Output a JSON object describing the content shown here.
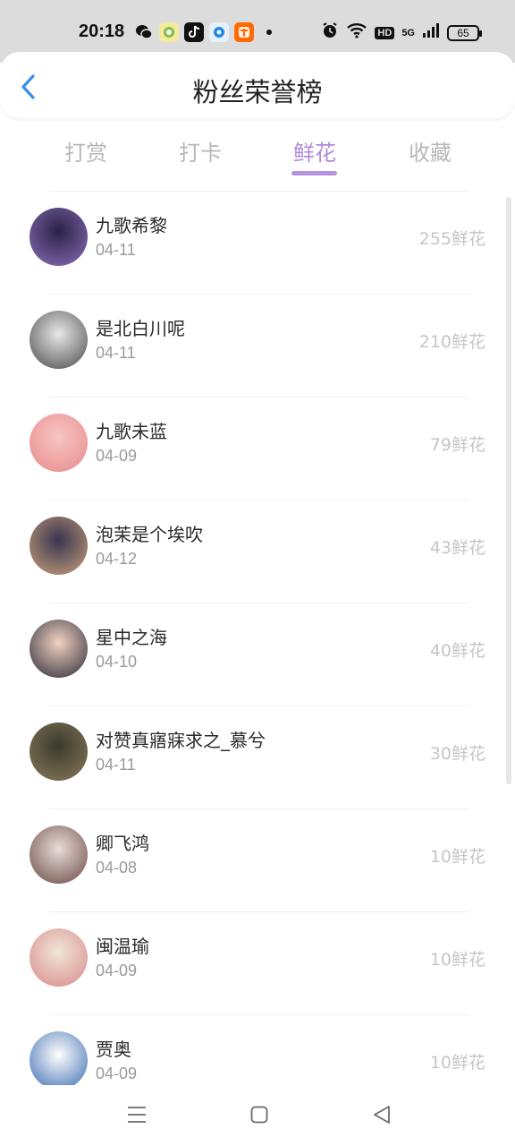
{
  "status_bar": {
    "time": "20:18",
    "battery": "65",
    "network_label": "HD",
    "cellular_label": "5G",
    "left_icons": [
      "wechat-icon",
      "app-icon",
      "tiktok-icon",
      "browser-icon",
      "taobao-icon"
    ],
    "right_icons": [
      "alarm-icon",
      "wifi-icon",
      "signal-icon",
      "battery-icon"
    ]
  },
  "header": {
    "title": "粉丝荣誉榜",
    "back_icon": "chevron-left-icon",
    "accent_color": "#3a8fe8"
  },
  "tabs": [
    {
      "label": "打赏",
      "active": false
    },
    {
      "label": "打卡",
      "active": false
    },
    {
      "label": "鲜花",
      "active": true
    },
    {
      "label": "收藏",
      "active": false
    }
  ],
  "tab_active_color": "#b08ad8",
  "fans": [
    {
      "name": "九歌希黎",
      "date": "04-11",
      "count": "255鲜花",
      "avatar_colors": [
        "#2a2146",
        "#8a6fb8"
      ]
    },
    {
      "name": "是北白川呢",
      "date": "04-11",
      "count": "210鲜花",
      "avatar_colors": [
        "#e8e8e8",
        "#4a4a4a"
      ]
    },
    {
      "name": "九歌未蓝",
      "date": "04-09",
      "count": "79鲜花",
      "avatar_colors": [
        "#f6c6c4",
        "#e88a8a"
      ]
    },
    {
      "name": "泡茉是个埃吹",
      "date": "04-12",
      "count": "43鲜花",
      "avatar_colors": [
        "#3a3550",
        "#c8a07a"
      ]
    },
    {
      "name": "星中之海",
      "date": "04-10",
      "count": "40鲜花",
      "avatar_colors": [
        "#f2d2c0",
        "#2a2a3a"
      ]
    },
    {
      "name": "对赞真寤寐求之_慕兮",
      "date": "04-11",
      "count": "30鲜花",
      "avatar_colors": [
        "#3a3a2e",
        "#8a7a5a"
      ]
    },
    {
      "name": "卿飞鸿",
      "date": "04-08",
      "count": "10鲜花",
      "avatar_colors": [
        "#e8dcd8",
        "#6a4a44"
      ]
    },
    {
      "name": "闽温瑜",
      "date": "04-09",
      "count": "10鲜花",
      "avatar_colors": [
        "#f0e6d8",
        "#d88a8a"
      ]
    },
    {
      "name": "贾奥",
      "date": "04-09",
      "count": "10鲜花",
      "avatar_colors": [
        "#ffffff",
        "#3a6ab0"
      ]
    }
  ],
  "nav_bar": {
    "icons": [
      "menu-icon",
      "home-icon",
      "back-icon"
    ]
  }
}
